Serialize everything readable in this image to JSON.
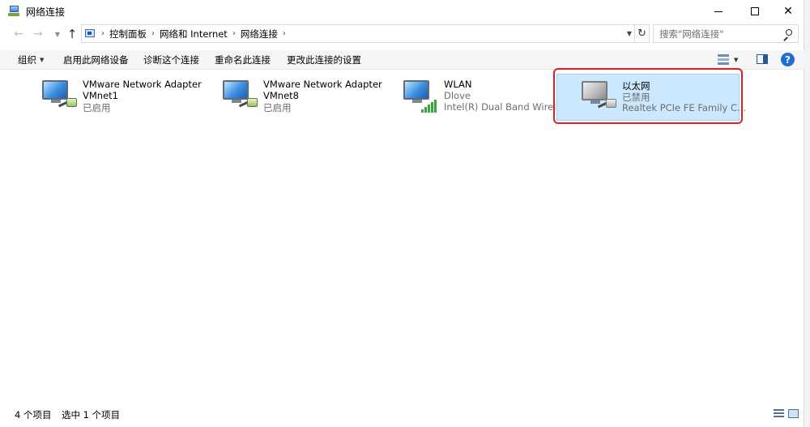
{
  "window": {
    "title": "网络连接",
    "controls": {
      "minimize": "—",
      "maximize": "□",
      "close": "✕"
    }
  },
  "nav": {
    "back_icon": "←",
    "forward_icon": "→",
    "up_icon": "↑",
    "breadcrumb": [
      "控制面板",
      "网络和 Internet",
      "网络连接"
    ],
    "separator": "›",
    "refresh_icon": "↻",
    "search_placeholder": "搜索\"网络连接\""
  },
  "toolbar": {
    "organize": "组织",
    "enable_device": "启用此网络设备",
    "diagnose": "诊断这个连接",
    "rename": "重命名此连接",
    "change_settings": "更改此连接的设置",
    "help": "?"
  },
  "connections": [
    {
      "name": "VMware Network Adapter",
      "line2": "VMnet1",
      "line3": "已启用",
      "icon": "network-adapter-icon",
      "selected": false
    },
    {
      "name": "VMware Network Adapter",
      "line2": "VMnet8",
      "line3": "已启用",
      "icon": "network-adapter-icon",
      "selected": false
    },
    {
      "name": "WLAN",
      "line2": "Dlove",
      "line3": "Intel(R) Dual Band Wirele...",
      "icon": "wireless-adapter-icon",
      "selected": false
    },
    {
      "name": "以太网",
      "line2": "已禁用",
      "line3": "Realtek PCIe FE Family C...",
      "icon": "disabled-ethernet-icon",
      "selected": true
    }
  ],
  "status": {
    "item_count": "4 个项目",
    "selected_count": "选中 1 个项目"
  },
  "colors": {
    "selection_bg": "#cce8ff",
    "selection_border": "#99d1ff",
    "annotation_red": "#e0201f",
    "help_blue": "#1f6fd1"
  }
}
